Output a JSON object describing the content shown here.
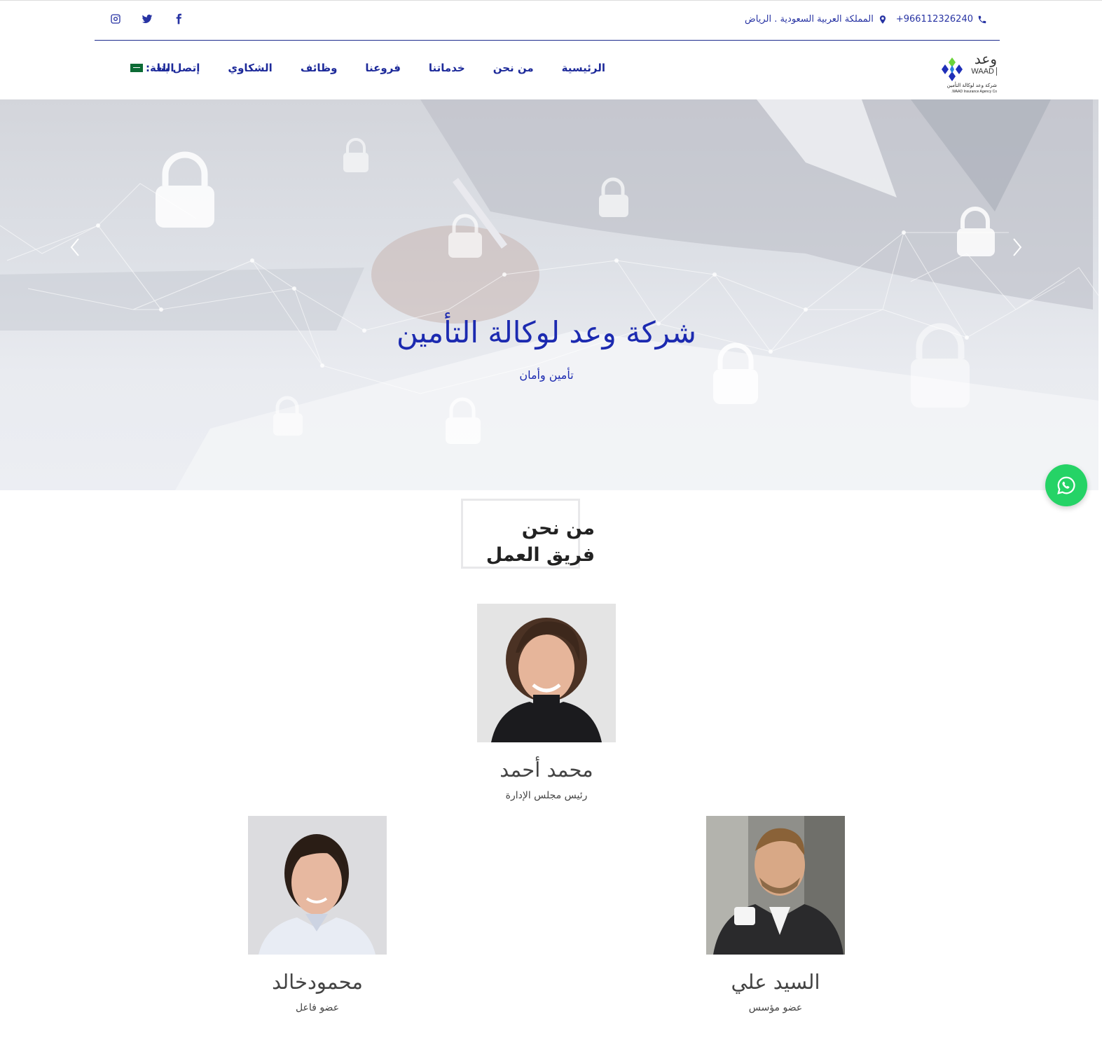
{
  "topbar": {
    "phone": "+966112326240",
    "address": "المملكة العربية السعودية . الرياض",
    "social": [
      {
        "icon": "facebook-icon"
      },
      {
        "icon": "twitter-icon"
      },
      {
        "icon": "instagram-icon"
      }
    ]
  },
  "logo": {
    "arabic": "وعد",
    "english": "WAAD",
    "tagline_ar": "شركة وعد لوكالة التأمين",
    "tagline_en": "WAAD Insurance Agency Co."
  },
  "nav": {
    "items": [
      "الرئيسية",
      "من نحن",
      "خدماتنا",
      "فروعنا",
      "وظائف",
      "الشكاوي",
      "إتصل بنا"
    ],
    "language_label": "اللغة:"
  },
  "hero": {
    "title": "شركة وعد لوكالة التأمين",
    "subtitle": "تأمين وأمان"
  },
  "about": {
    "heading": "من نحن",
    "subheading": "فريق العمل"
  },
  "team": [
    {
      "name": "محمد أحمد",
      "role": "رئيس مجلس الإدارة"
    },
    {
      "name": "محمودخالد",
      "role": "عضو فاعل"
    },
    {
      "name": "السيد علي",
      "role": "عضو مؤسس"
    }
  ],
  "colors": {
    "brand_blue": "#1c2ab0",
    "nav_blue": "#1d2a9a",
    "whatsapp_green": "#25d366"
  }
}
